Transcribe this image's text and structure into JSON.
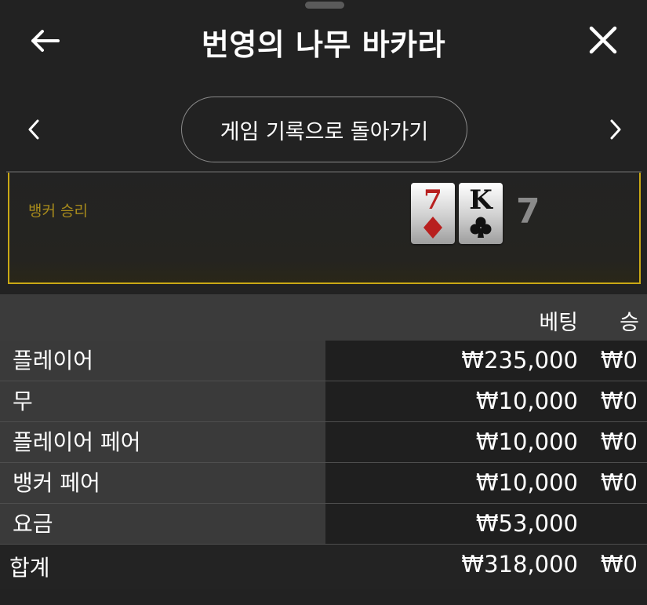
{
  "header": {
    "title": "번영의 나무 바카라"
  },
  "nav": {
    "history_button_label": "게임 기록으로 돌아가기"
  },
  "result": {
    "label": "뱅커 승리",
    "cards": [
      {
        "rank": "7",
        "suit": "diamond",
        "color": "#b8201f"
      },
      {
        "rank": "K",
        "suit": "club",
        "color": "#111111"
      }
    ],
    "score": "7",
    "accent_color": "#c9a815"
  },
  "table": {
    "headers": {
      "bet": "베팅",
      "win": "승"
    },
    "rows": [
      {
        "label": "플레이어",
        "bet": "₩235,000",
        "win": "₩0"
      },
      {
        "label": "무",
        "bet": "₩10,000",
        "win": "₩0"
      },
      {
        "label": "플레이어 페어",
        "bet": "₩10,000",
        "win": "₩0"
      },
      {
        "label": "뱅커 페어",
        "bet": "₩10,000",
        "win": "₩0"
      },
      {
        "label": "요금",
        "bet": "₩53,000",
        "win": ""
      }
    ],
    "total": {
      "label": "합계",
      "bet": "₩318,000",
      "win": "₩0"
    }
  }
}
